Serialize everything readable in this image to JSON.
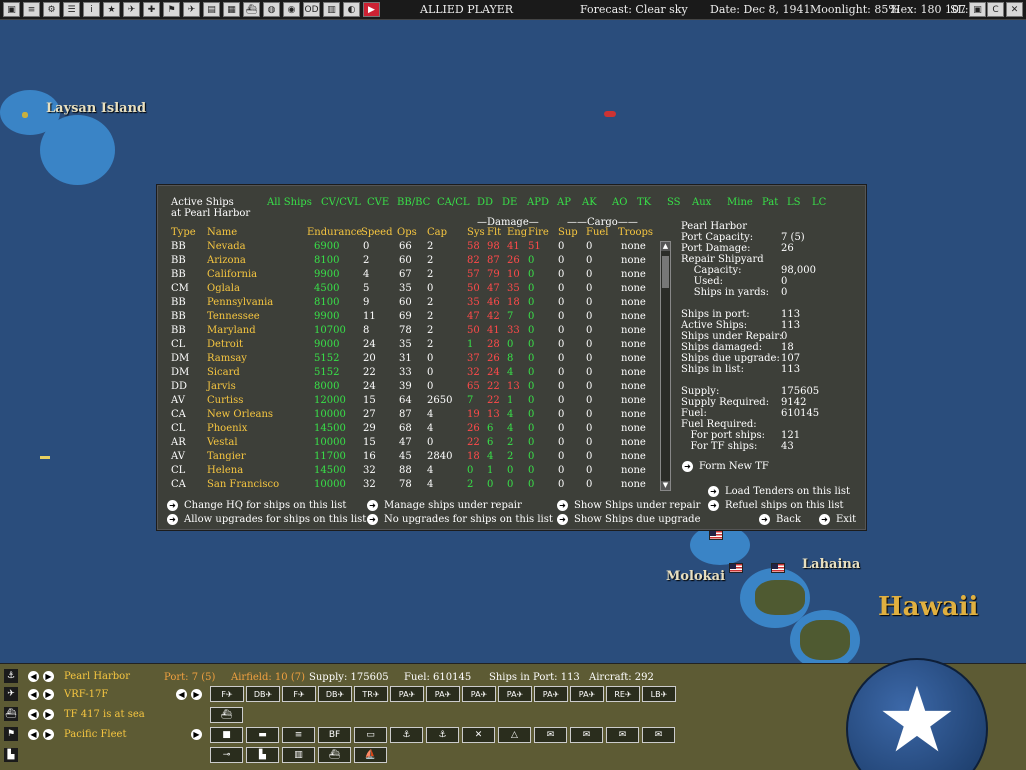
{
  "topbar": {
    "player": "ALLIED PLAYER",
    "forecast": "Forecast: Clear sky",
    "date": "Date: Dec 8, 1941",
    "moonlight": "Moonlight: 85%",
    "hex": "Hex: 180 107",
    "sl": "SL:"
  },
  "map": {
    "laysan": "Laysan Island",
    "molokai": "Molokai",
    "lahaina": "Lahaina",
    "hawaii": "Hawaii"
  },
  "panel": {
    "title_line1": "Active Ships",
    "title_line2": "at Pearl Harbor",
    "tabs": [
      "All Ships",
      "CV/CVL",
      "CVE",
      "BB/BC",
      "CA/CL",
      "DD",
      "DE",
      "APD",
      "AP",
      "AK",
      "AO",
      "TK",
      "SS",
      "Aux",
      "Mine",
      "Pat",
      "LS",
      "LC"
    ],
    "group_damage": "—Damage—",
    "group_cargo": "——Cargo——",
    "headers": {
      "type": "Type",
      "name": "Name",
      "endurance": "Endurance",
      "speed": "Speed",
      "ops": "Ops",
      "cap": "Cap",
      "sys": "Sys",
      "flt": "Flt",
      "eng": "Eng",
      "fire": "Fire",
      "sup": "Sup",
      "fuel": "Fuel",
      "troops": "Troops"
    },
    "ships": [
      {
        "type": "BB",
        "name": "Nevada",
        "endurance": "6900",
        "speed": "0",
        "ops": "66",
        "cap": "2",
        "sys": "58",
        "flt": "98",
        "eng": "41",
        "fire": "51",
        "sup": "0",
        "fuel": "0",
        "troops": "none"
      },
      {
        "type": "BB",
        "name": "Arizona",
        "endurance": "8100",
        "speed": "2",
        "ops": "60",
        "cap": "2",
        "sys": "82",
        "flt": "87",
        "eng": "26",
        "fire": "0",
        "sup": "0",
        "fuel": "0",
        "troops": "none"
      },
      {
        "type": "BB",
        "name": "California",
        "endurance": "9900",
        "speed": "4",
        "ops": "67",
        "cap": "2",
        "sys": "57",
        "flt": "79",
        "eng": "10",
        "fire": "0",
        "sup": "0",
        "fuel": "0",
        "troops": "none"
      },
      {
        "type": "CM",
        "name": "Oglala",
        "endurance": "4500",
        "speed": "5",
        "ops": "35",
        "cap": "0",
        "sys": "50",
        "flt": "47",
        "eng": "35",
        "fire": "0",
        "sup": "0",
        "fuel": "0",
        "troops": "none"
      },
      {
        "type": "BB",
        "name": "Pennsylvania",
        "endurance": "8100",
        "speed": "9",
        "ops": "60",
        "cap": "2",
        "sys": "35",
        "flt": "46",
        "eng": "18",
        "fire": "0",
        "sup": "0",
        "fuel": "0",
        "troops": "none"
      },
      {
        "type": "BB",
        "name": "Tennessee",
        "endurance": "9900",
        "speed": "11",
        "ops": "69",
        "cap": "2",
        "sys": "47",
        "flt": "42",
        "eng": "7",
        "fire": "0",
        "sup": "0",
        "fuel": "0",
        "troops": "none"
      },
      {
        "type": "BB",
        "name": "Maryland",
        "endurance": "10700",
        "speed": "8",
        "ops": "78",
        "cap": "2",
        "sys": "50",
        "flt": "41",
        "eng": "33",
        "fire": "0",
        "sup": "0",
        "fuel": "0",
        "troops": "none"
      },
      {
        "type": "CL",
        "name": "Detroit",
        "endurance": "9000",
        "speed": "24",
        "ops": "35",
        "cap": "2",
        "sys": "1",
        "flt": "28",
        "eng": "0",
        "fire": "0",
        "sup": "0",
        "fuel": "0",
        "troops": "none"
      },
      {
        "type": "DM",
        "name": "Ramsay",
        "endurance": "5152",
        "speed": "20",
        "ops": "31",
        "cap": "0",
        "sys": "37",
        "flt": "26",
        "eng": "8",
        "fire": "0",
        "sup": "0",
        "fuel": "0",
        "troops": "none"
      },
      {
        "type": "DM",
        "name": "Sicard",
        "endurance": "5152",
        "speed": "22",
        "ops": "33",
        "cap": "0",
        "sys": "32",
        "flt": "24",
        "eng": "4",
        "fire": "0",
        "sup": "0",
        "fuel": "0",
        "troops": "none"
      },
      {
        "type": "DD",
        "name": "Jarvis",
        "endurance": "8000",
        "speed": "24",
        "ops": "39",
        "cap": "0",
        "sys": "65",
        "flt": "22",
        "eng": "13",
        "fire": "0",
        "sup": "0",
        "fuel": "0",
        "troops": "none"
      },
      {
        "type": "AV",
        "name": "Curtiss",
        "endurance": "12000",
        "speed": "15",
        "ops": "64",
        "cap": "2650",
        "sys": "7",
        "flt": "22",
        "eng": "1",
        "fire": "0",
        "sup": "0",
        "fuel": "0",
        "troops": "none"
      },
      {
        "type": "CA",
        "name": "New Orleans",
        "endurance": "10000",
        "speed": "27",
        "ops": "87",
        "cap": "4",
        "sys": "19",
        "flt": "13",
        "eng": "4",
        "fire": "0",
        "sup": "0",
        "fuel": "0",
        "troops": "none"
      },
      {
        "type": "CL",
        "name": "Phoenix",
        "endurance": "14500",
        "speed": "29",
        "ops": "68",
        "cap": "4",
        "sys": "26",
        "flt": "6",
        "eng": "4",
        "fire": "0",
        "sup": "0",
        "fuel": "0",
        "troops": "none"
      },
      {
        "type": "AR",
        "name": "Vestal",
        "endurance": "10000",
        "speed": "15",
        "ops": "47",
        "cap": "0",
        "sys": "22",
        "flt": "6",
        "eng": "2",
        "fire": "0",
        "sup": "0",
        "fuel": "0",
        "troops": "none"
      },
      {
        "type": "AV",
        "name": "Tangier",
        "endurance": "11700",
        "speed": "16",
        "ops": "45",
        "cap": "2840",
        "sys": "18",
        "flt": "4",
        "eng": "2",
        "fire": "0",
        "sup": "0",
        "fuel": "0",
        "troops": "none"
      },
      {
        "type": "CL",
        "name": "Helena",
        "endurance": "14500",
        "speed": "32",
        "ops": "88",
        "cap": "4",
        "sys": "0",
        "flt": "1",
        "eng": "0",
        "fire": "0",
        "sup": "0",
        "fuel": "0",
        "troops": "none"
      },
      {
        "type": "CA",
        "name": "San Francisco",
        "endurance": "10000",
        "speed": "32",
        "ops": "78",
        "cap": "4",
        "sys": "2",
        "flt": "0",
        "eng": "0",
        "fire": "0",
        "sup": "0",
        "fuel": "0",
        "troops": "none"
      }
    ],
    "stats": [
      {
        "label": "Pearl Harbor",
        "value": ""
      },
      {
        "label": "Port Capacity:",
        "value": "7 (5)"
      },
      {
        "label": "Port Damage:",
        "value": "26"
      },
      {
        "label": "Repair Shipyard",
        "value": ""
      },
      {
        "label": "    Capacity:",
        "value": "98,000"
      },
      {
        "label": "    Used:",
        "value": "0"
      },
      {
        "label": "    Ships in yards:",
        "value": "0"
      },
      {
        "label": "",
        "value": ""
      },
      {
        "label": "Ships in port:",
        "value": "113"
      },
      {
        "label": "Active Ships:",
        "value": "113"
      },
      {
        "label": "Ships under Repair:",
        "value": "0"
      },
      {
        "label": "Ships damaged:",
        "value": "18"
      },
      {
        "label": "Ships due upgrade:",
        "value": "107"
      },
      {
        "label": "Ships in list:",
        "value": "113"
      },
      {
        "label": "",
        "value": ""
      },
      {
        "label": "Supply:",
        "value": "175605"
      },
      {
        "label": "Supply Required:",
        "value": "9142"
      },
      {
        "label": "Fuel:",
        "value": "610145"
      },
      {
        "label": "Fuel Required:",
        "value": ""
      },
      {
        "label": "   For port ships:",
        "value": "121"
      },
      {
        "label": "   For TF ships:",
        "value": "43"
      }
    ],
    "actions": {
      "form_new_tf": "Form New TF",
      "change_hq": "Change HQ for ships on this list",
      "allow_upgrades": "Allow upgrades for ships on this list",
      "manage_repair": "Manage ships under repair",
      "no_upgrades": "No upgrades for ships on this list",
      "show_repair": "Show Ships under repair",
      "show_upgrade": "Show Ships due upgrade",
      "load_tenders": "Load Tenders on this list",
      "refuel": "Refuel ships on this list",
      "back": "Back",
      "exit": "Exit"
    }
  },
  "bottom": {
    "base": "Pearl Harbor",
    "unit": "VRF-17F",
    "tf": "TF 417 is at sea",
    "hq": "Pacific Fleet",
    "port": "Port: 7 (5)",
    "airfield": "Airfield: 10 (7)",
    "supply": "Supply: 175605",
    "fuel": "Fuel: 610145",
    "ships_in_port": "Ships in Port: 113",
    "aircraft": "Aircraft: 292",
    "plane_buttons": [
      "F",
      "DB",
      "F",
      "DB",
      "TR",
      "PA",
      "PA",
      "PA",
      "PA",
      "PA",
      "PA",
      "RE",
      "LB"
    ],
    "ship_buttons": [
      "■",
      "▬",
      "≡",
      "BF",
      "▭",
      "⚓",
      "⚓",
      "✕",
      "△",
      "✉",
      "✉",
      "✉",
      "✉"
    ]
  },
  "colors": {
    "accent_yellow": "#f6c640",
    "accent_green": "#38e048",
    "damage_red": "#ff4a4a"
  }
}
